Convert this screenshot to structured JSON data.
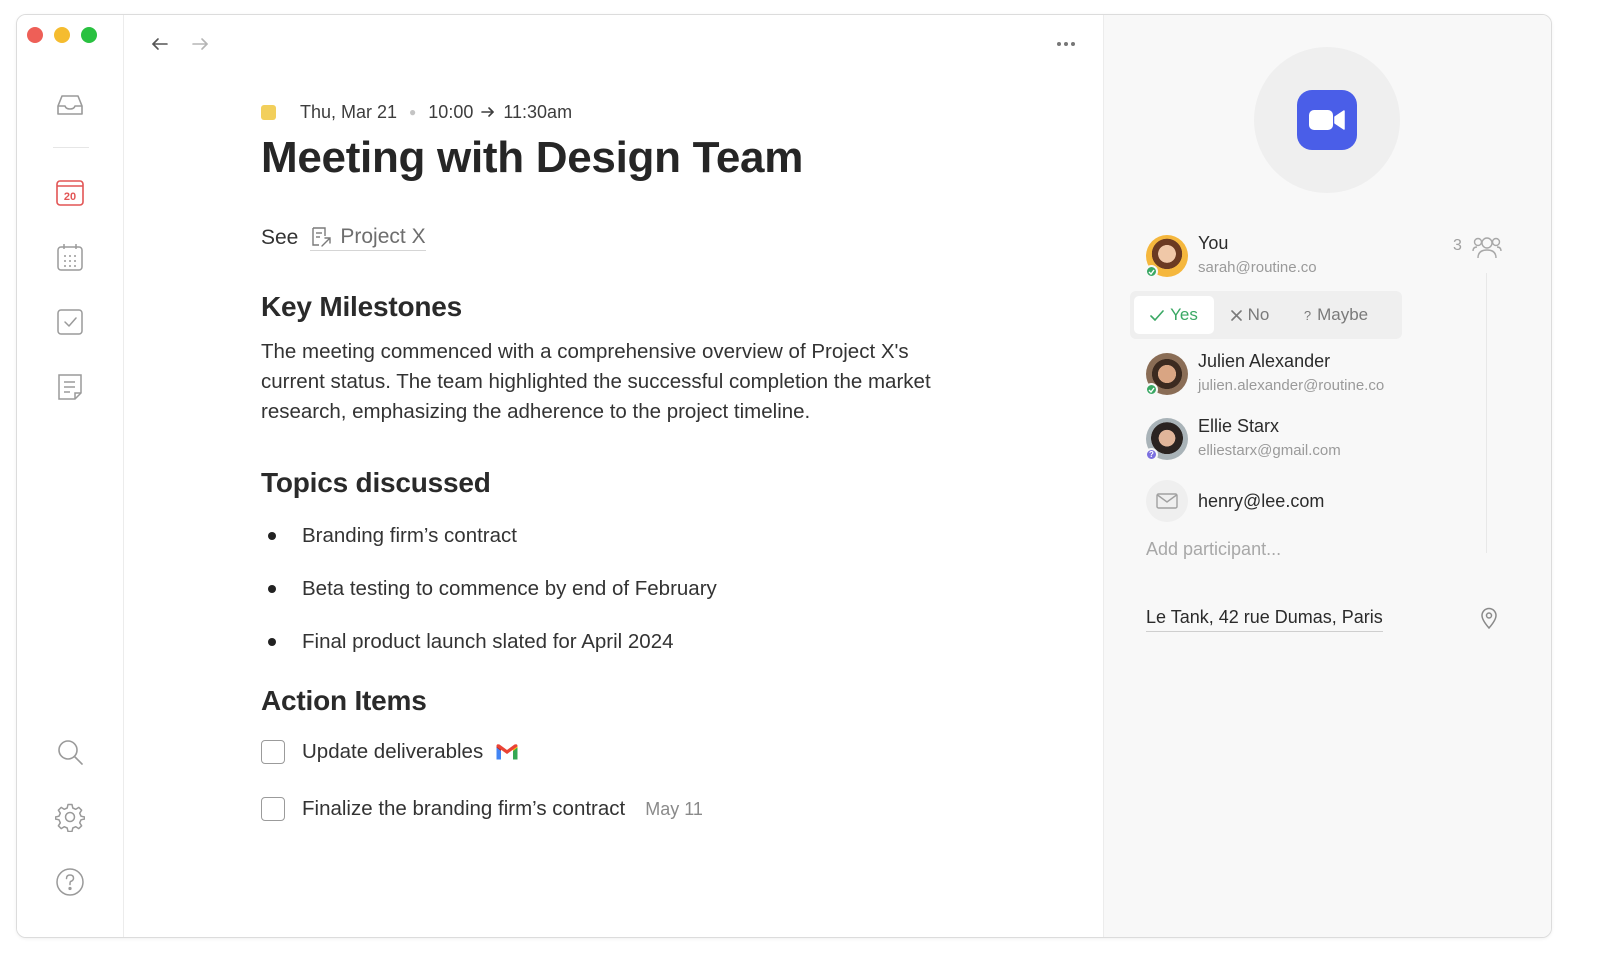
{
  "colors": {
    "close": "#ee5f57",
    "minimize": "#f5bc2f",
    "maximize": "#29c140",
    "calendar_accent": "#e25555",
    "zoom_blue": "#4a5ee8",
    "event_color": "#f2cf5b",
    "accept_green": "#3aa864",
    "maybe_purple": "#7b6fe0"
  },
  "sidebar": {
    "items": [
      {
        "name": "inbox",
        "icon": "inbox-icon"
      },
      {
        "name": "today",
        "icon": "calendar-day-icon",
        "label": "20"
      },
      {
        "name": "calendar",
        "icon": "calendar-grid-icon"
      },
      {
        "name": "tasks",
        "icon": "checkbox-icon"
      },
      {
        "name": "notes",
        "icon": "note-icon"
      }
    ],
    "bottom": [
      {
        "name": "search",
        "icon": "search-icon"
      },
      {
        "name": "settings",
        "icon": "gear-icon"
      },
      {
        "name": "help",
        "icon": "help-icon"
      }
    ]
  },
  "event": {
    "date": "Thu, Mar 21",
    "start": "10:00",
    "end": "11:30am",
    "title": "Meeting with Design Team",
    "see_label": "See",
    "project_link": "Project X"
  },
  "sections": {
    "milestones_heading": "Key Milestones",
    "milestones_text": "The meeting commenced with a comprehensive overview of Project X's current status. The team highlighted the successful completion the market research, emphasizing the adherence to the project timeline.",
    "topics_heading": "Topics discussed",
    "topics": [
      "Branding firm’s contract",
      "Beta testing to commence by end of February",
      "Final product launch slated for April 2024"
    ],
    "actions_heading": "Action Items",
    "actions": [
      {
        "label": "Update deliverables",
        "badge": "gmail-icon",
        "due": ""
      },
      {
        "label": "Finalize the branding firm’s contract",
        "badge": "",
        "due": "May 11"
      }
    ]
  },
  "panel": {
    "conference": "zoom-icon",
    "participant_count": "3",
    "participants": [
      {
        "name": "You",
        "email": "sarah@routine.co",
        "status": "accepted"
      },
      {
        "name": "Julien Alexander",
        "email": "julien.alexander@routine.co",
        "status": "accepted"
      },
      {
        "name": "Ellie Starx",
        "email": "elliestarx@gmail.com",
        "status": "maybe"
      },
      {
        "name": "",
        "email": "henry@lee.com",
        "status": "none"
      }
    ],
    "rsvp": {
      "yes": "Yes",
      "no": "No",
      "maybe": "Maybe"
    },
    "add_placeholder": "Add participant...",
    "location": "Le Tank, 42 rue Dumas, Paris"
  }
}
